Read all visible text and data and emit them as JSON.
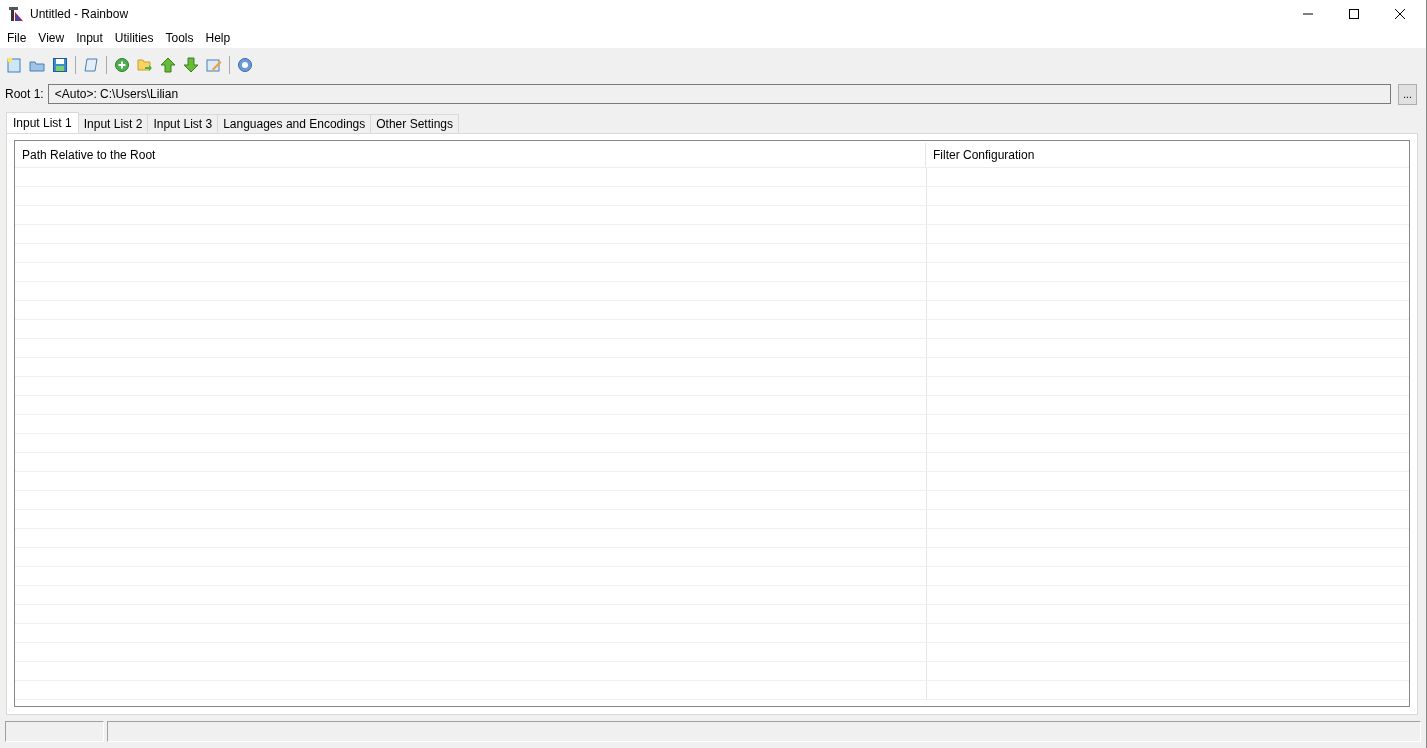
{
  "window": {
    "title": "Untitled - Rainbow"
  },
  "menu": [
    "File",
    "View",
    "Input",
    "Utilities",
    "Tools",
    "Help"
  ],
  "root": {
    "label": "Root 1:",
    "value": "<Auto>:  C:\\Users\\Lilian",
    "browse": "..."
  },
  "tabs": [
    {
      "label": "Input List 1",
      "selected": true
    },
    {
      "label": "Input List 2",
      "selected": false
    },
    {
      "label": "Input List 3",
      "selected": false
    },
    {
      "label": "Languages and Encodings",
      "selected": false
    },
    {
      "label": "Other Settings",
      "selected": false
    }
  ],
  "table": {
    "columns": [
      "Path Relative to the Root",
      "Filter Configuration"
    ]
  }
}
